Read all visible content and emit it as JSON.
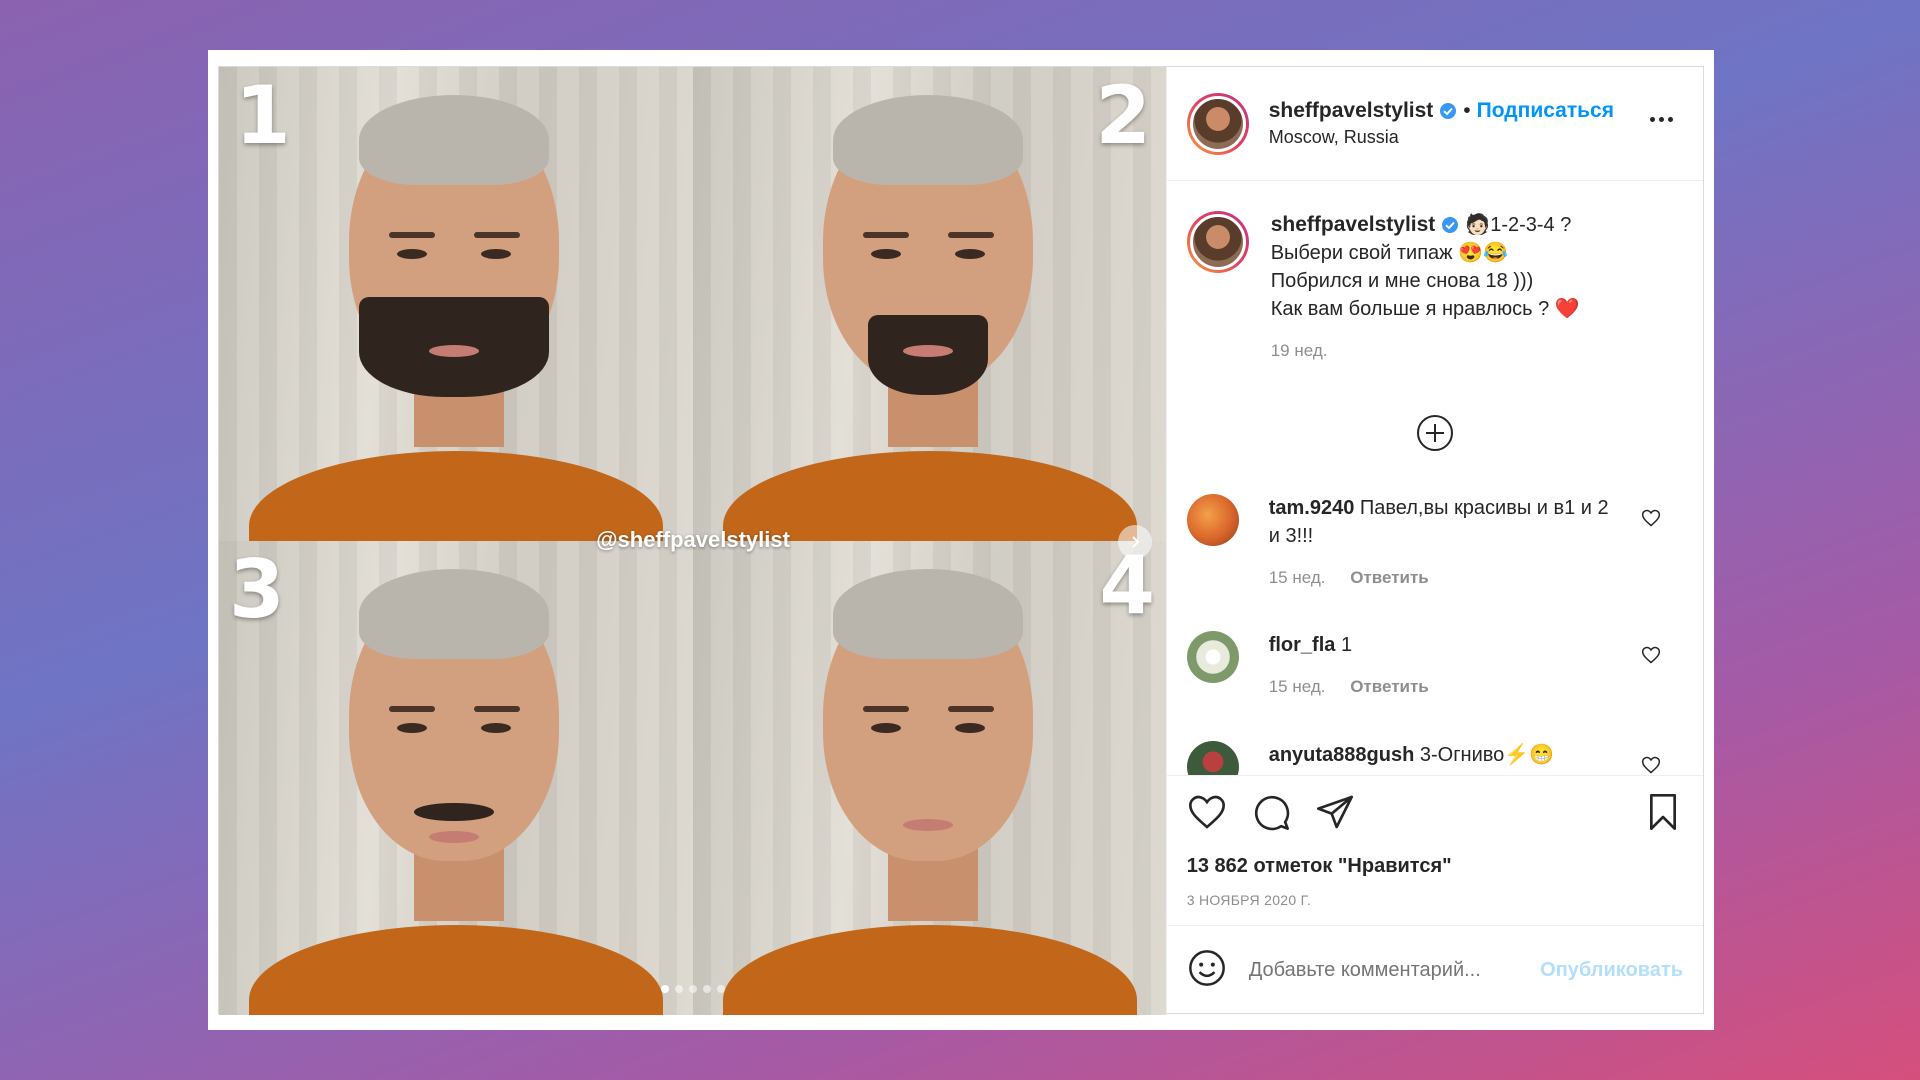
{
  "media": {
    "quadrant_numbers": [
      "1",
      "2",
      "3",
      "4"
    ],
    "watermark": "@sheffpavelstylist",
    "slide_count": 5,
    "active_slide": 1
  },
  "header": {
    "username": "sheffpavelstylist",
    "separator": "•",
    "follow_label": "Подписаться",
    "location": "Moscow, Russia"
  },
  "caption": {
    "username": "sheffpavelstylist",
    "lines": [
      "🧑🏻1-2-3-4 ?",
      "Выбери свой типаж 😍😂",
      "Побрился и мне снова 18 )))",
      "Как вам больше я нравлюсь ? ❤️"
    ],
    "time": "19 нед."
  },
  "comments": [
    {
      "username": "tam.9240",
      "text": "Павел,вы красивы и в1 и 2 и 3!!!",
      "time": "15 нед.",
      "reply_label": "Ответить",
      "avatar_color": "#d9652b"
    },
    {
      "username": "flor_fla",
      "text": "1",
      "time": "15 нед.",
      "reply_label": "Ответить",
      "avatar_color": "#cfd9c2"
    },
    {
      "username": "anyuta888gush",
      "text": "3-Огниво⚡😁",
      "time": "",
      "reply_label": "",
      "avatar_color": "#3d5a3a"
    }
  ],
  "actions": {
    "likes": "13 862 отметок \"Нравится\"",
    "date": "3 НОЯБРЯ 2020 Г."
  },
  "add_comment": {
    "placeholder": "Добавьте комментарий...",
    "publish_label": "Опубликовать"
  },
  "colors": {
    "link": "#0095f6",
    "publish_disabled": "#b2dffc",
    "heart": "#ed4956",
    "shirt": "#c2671a"
  }
}
